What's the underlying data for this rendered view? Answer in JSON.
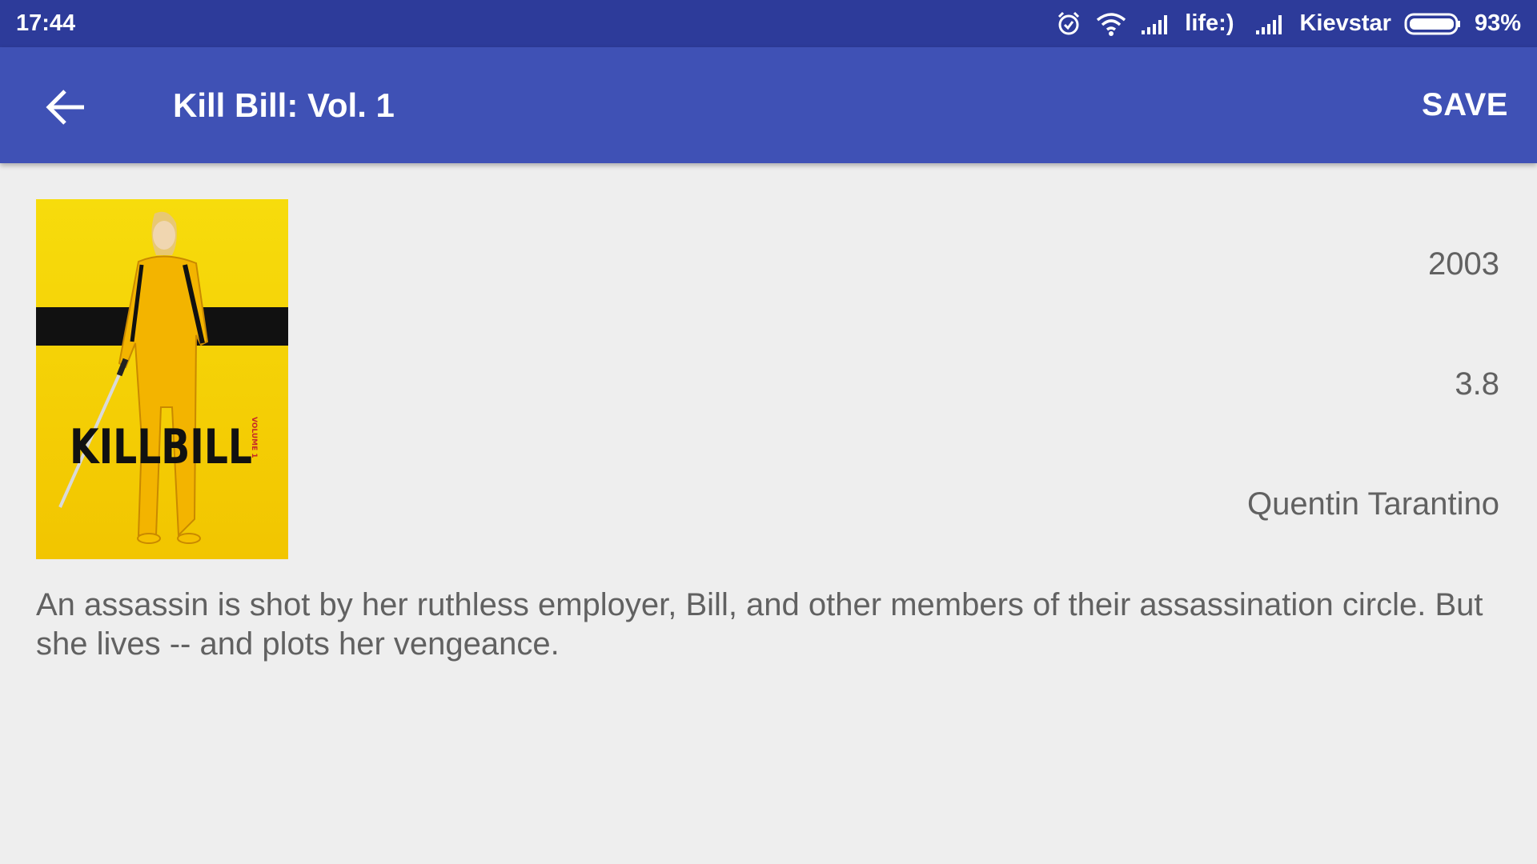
{
  "status_bar": {
    "time": "17:44",
    "carrier1": "life:)",
    "carrier2": "Kievstar",
    "battery": "93%",
    "icons": [
      "alarm-icon",
      "wifi-icon",
      "signal-icon",
      "signal-icon",
      "battery-icon"
    ]
  },
  "app_bar": {
    "back_icon": "arrow-back-icon",
    "title": "Kill Bill: Vol. 1",
    "save_label": "SAVE"
  },
  "movie": {
    "poster_text": "KILLBILL",
    "poster_subtext": "VOLUME 1",
    "year": "2003",
    "rating": "3.8",
    "director": "Quentin Tarantino",
    "description": "An assassin is shot by her ruthless employer, Bill, and other members of their assassination circle. But she lives -- and plots her vengeance."
  },
  "colors": {
    "status_bar": "#2d3b9a",
    "app_bar": "#3f51b5",
    "background": "#eeeeee",
    "text_secondary": "#616161",
    "poster_yellow": "#f5d90a"
  }
}
